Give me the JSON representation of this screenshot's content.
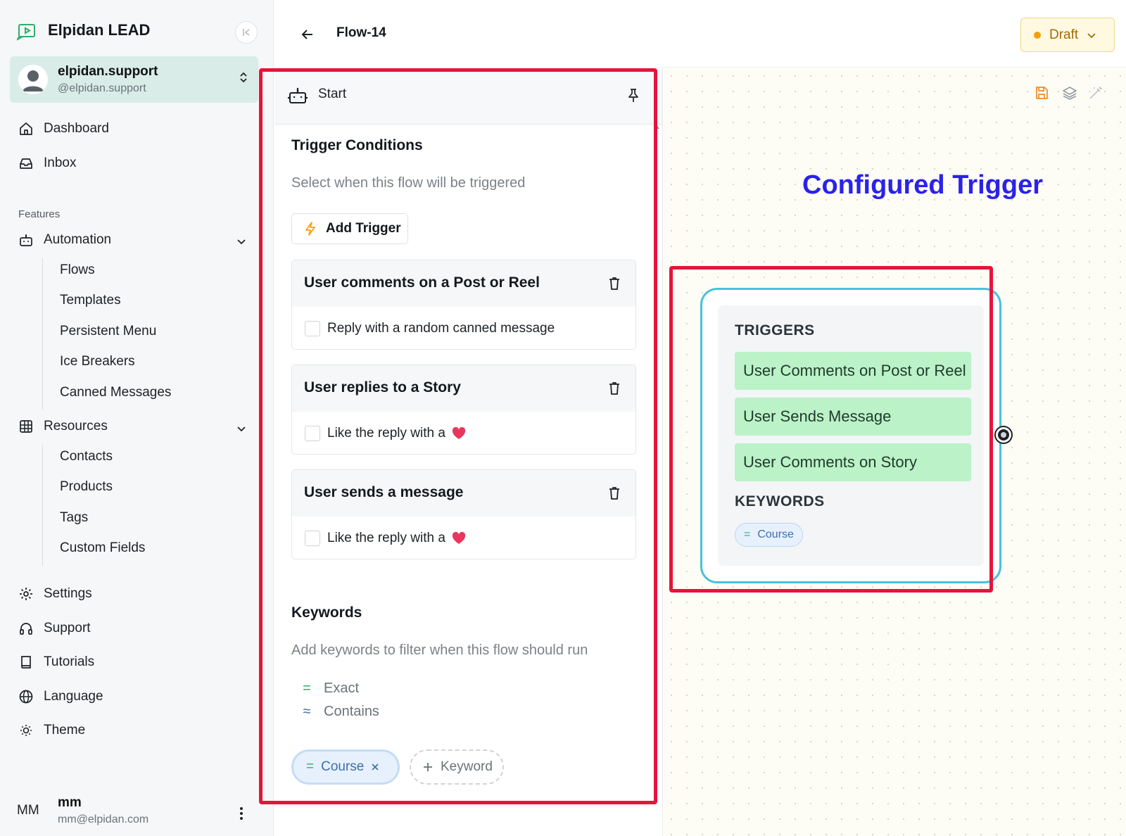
{
  "sidebar": {
    "brand": "Elpidan LEAD",
    "account": {
      "name": "elpidan.support",
      "handle": "@elpidan.support"
    },
    "nav_top": [
      {
        "label": "Dashboard",
        "icon": "home-icon"
      },
      {
        "label": "Inbox",
        "icon": "inbox-icon"
      }
    ],
    "features_label": "Features",
    "automation": {
      "label": "Automation",
      "icon": "robot-icon",
      "items": [
        "Flows",
        "Templates",
        "Persistent Menu",
        "Ice Breakers",
        "Canned Messages"
      ]
    },
    "resources": {
      "label": "Resources",
      "icon": "grid-icon",
      "items": [
        "Contacts",
        "Products",
        "Tags",
        "Custom Fields"
      ]
    },
    "nav_bottom": [
      {
        "label": "Settings",
        "icon": "gear-icon"
      },
      {
        "label": "Support",
        "icon": "headset-icon"
      },
      {
        "label": "Tutorials",
        "icon": "book-icon"
      },
      {
        "label": "Language",
        "icon": "globe-icon"
      },
      {
        "label": "Theme",
        "icon": "sun-icon"
      }
    ],
    "user": {
      "initials": "MM",
      "name": "mm",
      "email": "mm@elpidan.com"
    }
  },
  "header": {
    "title": "Flow-14",
    "status": "Draft"
  },
  "panel": {
    "start_label": "Start",
    "trigger_title": "Trigger Conditions",
    "trigger_subtitle": "Select when this flow will be triggered",
    "add_trigger_label": "Add Trigger",
    "triggers": [
      {
        "title": "User comments on a Post or Reel",
        "option": "Reply with a random canned message",
        "heart": false
      },
      {
        "title": "User replies to a Story",
        "option": "Like the reply with a",
        "heart": true
      },
      {
        "title": "User sends a message",
        "option": "Like the reply with a",
        "heart": true
      }
    ],
    "keywords_title": "Keywords",
    "keywords_subtitle": "Add keywords to filter when this flow should run",
    "match_types": [
      {
        "symbol": "=",
        "label": "Exact"
      },
      {
        "symbol": "≈",
        "label": "Contains"
      }
    ],
    "keyword_chip": {
      "symbol": "=",
      "label": "Course"
    },
    "add_keyword_label": "Keyword"
  },
  "canvas": {
    "annotation": "Configured Trigger",
    "node": {
      "triggers_label": "TRIGGERS",
      "triggers": [
        "User Comments on Post or Reel",
        "User Sends Message",
        "User Comments on Story"
      ],
      "keywords_label": "KEYWORDS",
      "keyword": {
        "symbol": "=",
        "label": "Course"
      }
    }
  },
  "colors": {
    "accent_teal": "#46c2dc",
    "annotation_red": "#e5143a",
    "annotation_blue": "#2b22ea",
    "trigger_green": "#bbf2c8",
    "draft_amber": "#f59e0b"
  }
}
